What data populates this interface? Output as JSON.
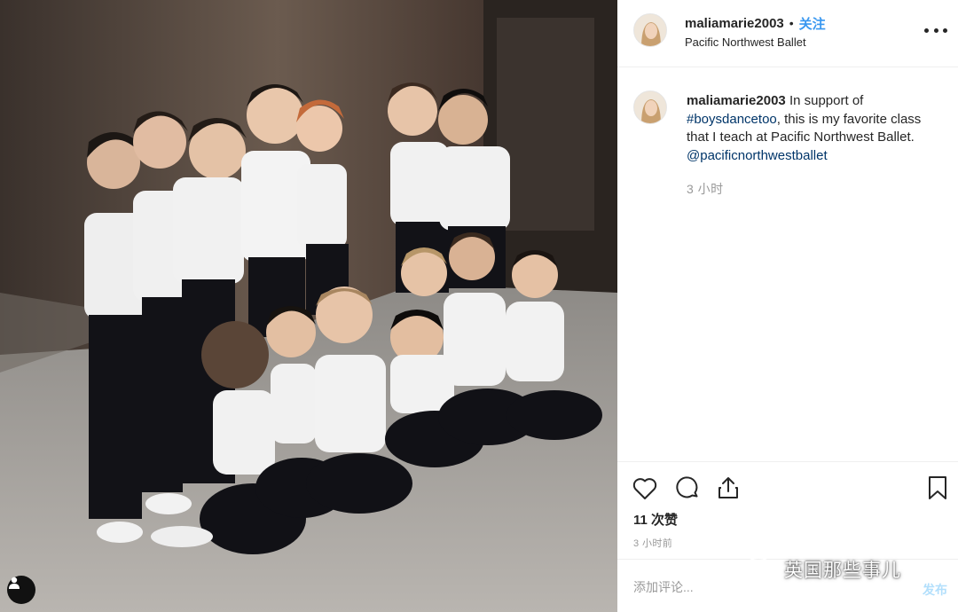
{
  "post": {
    "username": "maliamarie2003",
    "separator": "•",
    "follow_label": "关注",
    "location": "Pacific Northwest Ballet",
    "more_icon": "more-horizontal-icon",
    "photo_alt": "photo of young boys in white t-shirts and black tights"
  },
  "caption": {
    "username": "maliamarie2003",
    "text_1": "In support of",
    "hashtag": "#boysdancetoo",
    "text_2": ", this is my favorite class that I teach at Pacific Northwest Ballet.",
    "mention": "@pacificnorthwestballet",
    "time": "3 小时"
  },
  "actions": {
    "like_icon": "heart-icon",
    "comment_icon": "comment-icon",
    "share_icon": "share-icon",
    "save_icon": "bookmark-icon",
    "likes": "11 次赞",
    "post_time": "3 小时前"
  },
  "comment_box": {
    "placeholder": "添加评论...",
    "post_label": "发布"
  },
  "watermark": {
    "text": "英国那些事儿"
  },
  "colors": {
    "link_blue": "#3897f0",
    "dark_link": "#003569",
    "muted": "#999999",
    "border": "#efefef"
  }
}
